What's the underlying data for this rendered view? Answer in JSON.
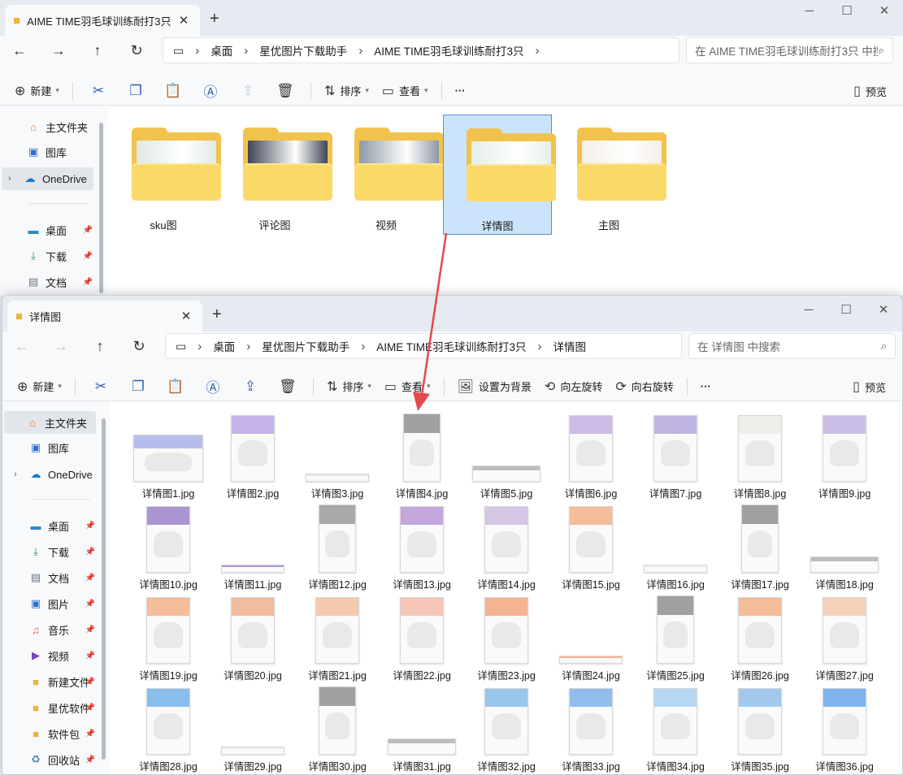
{
  "win1": {
    "tab_title": "AIME TIME羽毛球训练耐打3只",
    "crumbs": [
      "桌面",
      "星优图片下载助手",
      "AIME TIME羽毛球训练耐打3只"
    ],
    "search_placeholder": "在 AIME TIME羽毛球训练耐打3只 中搜索",
    "toolbar": {
      "new": "新建",
      "sort": "排序",
      "view": "查看",
      "more": "···",
      "preview": "预览"
    },
    "sidebar": {
      "home": "主文件夹",
      "gallery": "图库",
      "onedrive": "OneDrive",
      "desktop": "桌面",
      "downloads": "下载",
      "documents": "文档"
    },
    "folders": [
      {
        "name": "sku图",
        "tint": "#dfe9e3"
      },
      {
        "name": "评论图",
        "tint": "#3f4656"
      },
      {
        "name": "视频",
        "tint": "#8e98a6"
      },
      {
        "name": "详情图",
        "tint": "#e4efe9",
        "selected": true
      },
      {
        "name": "主图",
        "tint": "#f4efe6"
      }
    ]
  },
  "win2": {
    "tab_title": "详情图",
    "crumbs": [
      "桌面",
      "星优图片下载助手",
      "AIME TIME羽毛球训练耐打3只",
      "详情图"
    ],
    "search_placeholder": "在 详情图 中搜索",
    "toolbar": {
      "new": "新建",
      "sort": "排序",
      "view": "查看",
      "set_bg": "设置为背景",
      "rotate_left": "向左旋转",
      "rotate_right": "向右旋转",
      "more": "···",
      "preview": "预览"
    },
    "sidebar": {
      "home": "主文件夹",
      "gallery": "图库",
      "onedrive": "OneDrive",
      "desktop": "桌面",
      "downloads": "下载",
      "documents": "文档",
      "pictures": "图片",
      "music": "音乐",
      "videos": "视频",
      "newfolder": "新建文件",
      "xingyou": "星优软件",
      "packages": "软件包",
      "recycle": "回收站"
    },
    "files": [
      {
        "name": "详情图1.jpg",
        "shape": "sq",
        "accent": "#7a8be0"
      },
      {
        "name": "详情图2.jpg",
        "shape": "tall",
        "accent": "#9a7ad8"
      },
      {
        "name": "详情图3.jpg",
        "shape": "strip",
        "accent": "#d8d8d8"
      },
      {
        "name": "详情图4.jpg",
        "shape": "long",
        "accent": "#555555"
      },
      {
        "name": "详情图5.jpg",
        "shape": "wide",
        "accent": "#8a8a8a"
      },
      {
        "name": "详情图6.jpg",
        "shape": "tall",
        "accent": "#a889d8"
      },
      {
        "name": "详情图7.jpg",
        "shape": "tall",
        "accent": "#8f7ad0"
      },
      {
        "name": "详情图8.jpg",
        "shape": "tall",
        "accent": "#e8e3dc"
      },
      {
        "name": "详情图9.jpg",
        "shape": "tall",
        "accent": "#a08ad8"
      },
      {
        "name": "详情图10.jpg",
        "shape": "tall",
        "accent": "#6a3fb0"
      },
      {
        "name": "详情图11.jpg",
        "shape": "strip",
        "accent": "#6d3fb6"
      },
      {
        "name": "详情图12.jpg",
        "shape": "long",
        "accent": "#666666"
      },
      {
        "name": "详情图13.jpg",
        "shape": "tall",
        "accent": "#9563c4"
      },
      {
        "name": "详情图14.jpg",
        "shape": "tall",
        "accent": "#b59ad4"
      },
      {
        "name": "详情图15.jpg",
        "shape": "tall",
        "accent": "#f08a4a"
      },
      {
        "name": "详情图16.jpg",
        "shape": "strip",
        "accent": "#e0e0e0"
      },
      {
        "name": "详情图17.jpg",
        "shape": "long",
        "accent": "#555555"
      },
      {
        "name": "详情图18.jpg",
        "shape": "wide",
        "accent": "#8a8a8a"
      },
      {
        "name": "详情图19.jpg",
        "shape": "tall",
        "accent": "#f08a4a"
      },
      {
        "name": "详情图20.jpg",
        "shape": "tall",
        "accent": "#ea8a55"
      },
      {
        "name": "详情图21.jpg",
        "shape": "tall",
        "accent": "#f0a070"
      },
      {
        "name": "详情图22.jpg",
        "shape": "tall",
        "accent": "#f09a80"
      },
      {
        "name": "详情图23.jpg",
        "shape": "tall",
        "accent": "#f07a3a"
      },
      {
        "name": "详情图24.jpg",
        "shape": "strip",
        "accent": "#f07a3a"
      },
      {
        "name": "详情图25.jpg",
        "shape": "long",
        "accent": "#555555"
      },
      {
        "name": "详情图26.jpg",
        "shape": "tall",
        "accent": "#f08a4a"
      },
      {
        "name": "详情图27.jpg",
        "shape": "tall",
        "accent": "#f0b080"
      },
      {
        "name": "详情图28.jpg",
        "shape": "tall",
        "accent": "#2a8ae0"
      },
      {
        "name": "详情图29.jpg",
        "shape": "strip",
        "accent": "#e0e0e0"
      },
      {
        "name": "详情图30.jpg",
        "shape": "long",
        "accent": "#555555"
      },
      {
        "name": "详情图31.jpg",
        "shape": "wide",
        "accent": "#8a8a8a"
      },
      {
        "name": "详情图32.jpg",
        "shape": "tall",
        "accent": "#4a9ae0"
      },
      {
        "name": "详情图33.jpg",
        "shape": "tall",
        "accent": "#3a8ae0"
      },
      {
        "name": "详情图34.jpg",
        "shape": "tall",
        "accent": "#80b8ea"
      },
      {
        "name": "详情图35.jpg",
        "shape": "tall",
        "accent": "#5aa0e0"
      },
      {
        "name": "详情图36.jpg",
        "shape": "tall",
        "accent": "#1a7ae0"
      }
    ]
  },
  "colors": {
    "accent": "#0a64c8",
    "folder": "#f1c24c",
    "arrow": "#e5484d",
    "selected_bg": "#cce4fb"
  }
}
